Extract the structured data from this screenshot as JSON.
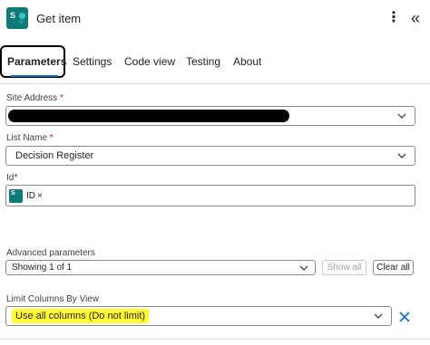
{
  "header": {
    "title": "Get item",
    "icon": "sharepoint-icon",
    "more_icon": "⋮",
    "collapse_icon": "«"
  },
  "tabs": [
    {
      "label": "Parameters",
      "active": true
    },
    {
      "label": "Settings"
    },
    {
      "label": "Code view"
    },
    {
      "label": "Testing"
    },
    {
      "label": "About"
    }
  ],
  "form": {
    "site_address": {
      "label": "Site Address",
      "required": "*"
    },
    "list_name": {
      "label": "List Name",
      "required": "*",
      "value": "Decision Register"
    },
    "id": {
      "label": "Id",
      "required": "*",
      "token": "ID",
      "token_remove": "×"
    },
    "advanced": {
      "label": "Advanced parameters",
      "value": "Showing 1 of 1",
      "show_all": "Show all",
      "clear_all": "Clear all"
    },
    "limit_columns": {
      "label": "Limit Columns By View",
      "value": "Use all columns (Do not limit)",
      "highlight_color": "#ffff33"
    }
  },
  "colors": {
    "accent": "#0f6cbd",
    "sharepoint": "#0f7b74",
    "required": "#c50f1f"
  }
}
